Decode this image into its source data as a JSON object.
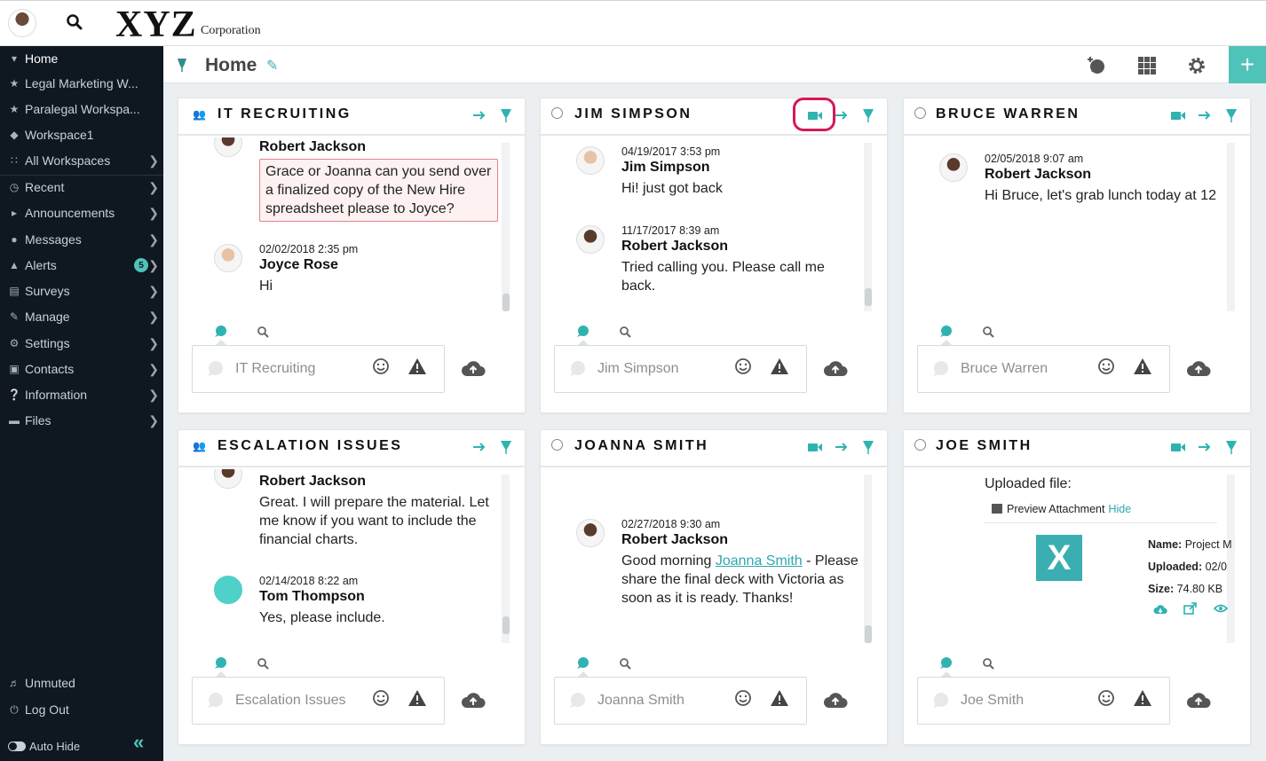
{
  "header": {
    "logo_main": "XYZ",
    "logo_sub": "Corporation"
  },
  "sidebar": {
    "items": [
      {
        "label": "Home",
        "icon": "pin-icon"
      },
      {
        "label": "Legal Marketing W...",
        "icon": "star-icon"
      },
      {
        "label": "Paralegal Workspa...",
        "icon": "star-icon"
      },
      {
        "label": "Workspace1",
        "icon": "workspace-icon"
      },
      {
        "label": "All Workspaces",
        "icon": "grid-icon"
      },
      {
        "label": "Recent",
        "icon": "history-icon"
      },
      {
        "label": "Announcements",
        "icon": "megaphone-icon"
      },
      {
        "label": "Messages",
        "icon": "chat-icon"
      },
      {
        "label": "Alerts",
        "icon": "alert-icon",
        "badge": "5"
      },
      {
        "label": "Surveys",
        "icon": "clipboard-icon"
      },
      {
        "label": "Manage",
        "icon": "pencil-icon"
      },
      {
        "label": "Settings",
        "icon": "gear-icon"
      },
      {
        "label": "Contacts",
        "icon": "contacts-icon"
      },
      {
        "label": "Information",
        "icon": "question-icon"
      },
      {
        "label": "Files",
        "icon": "folder-icon"
      }
    ],
    "unmuted": "Unmuted",
    "logout": "Log Out",
    "auto_hide": "Auto Hide"
  },
  "titlebar": {
    "title": "Home"
  },
  "colors": {
    "accent": "#4fc3b8",
    "sidebar_bg": "#0f1720",
    "highlight": "#d6175a",
    "link": "#2fa8b0"
  },
  "cards": [
    {
      "title": "IT RECRUITING",
      "placeholder": "IT Recruiting",
      "messages": [
        {
          "name": "Robert Jackson",
          "text": "Grace or Joanna can you send over a finalized copy of the New Hire spreadsheet please to Joyce?"
        },
        {
          "ts": "02/02/2018 2:35 pm",
          "name": "Joyce Rose",
          "text": "Hi"
        }
      ]
    },
    {
      "title": "JIM SIMPSON",
      "placeholder": "Jim Simpson",
      "messages": [
        {
          "ts": "04/19/2017 3:53 pm",
          "name": "Jim Simpson",
          "text": "Hi! just got back"
        },
        {
          "ts": "11/17/2017 8:39 am",
          "name": "Robert Jackson",
          "text": "Tried calling you. Please call me back."
        }
      ]
    },
    {
      "title": "BRUCE WARREN",
      "placeholder": "Bruce Warren",
      "messages": [
        {
          "ts": "02/05/2018 9:07 am",
          "name": "Robert Jackson",
          "text": "Hi Bruce, let's grab lunch today at 12"
        }
      ]
    },
    {
      "title": "ESCALATION ISSUES",
      "placeholder": "Escalation Issues",
      "messages": [
        {
          "name": "Robert Jackson",
          "text": "Great.  I will prepare the material.  Let me know if you want to include the financial charts."
        },
        {
          "ts": "02/14/2018 8:22 am",
          "name": "Tom Thompson",
          "text": "Yes, please include."
        }
      ]
    },
    {
      "title": "JOANNA SMITH",
      "placeholder": "Joanna Smith",
      "messages": [
        {
          "ts": "02/27/2018 9:30 am",
          "name": "Robert Jackson",
          "text_pre": "Good morning ",
          "mention": "Joanna Smith",
          "text_post": " - Please share the final deck with Victoria as soon as it is ready. Thanks!"
        }
      ]
    },
    {
      "title": "JOE SMITH",
      "placeholder": "Joe Smith",
      "attachment": {
        "uploaded_label": "Uploaded file:",
        "preview_label": "Preview Attachment",
        "hide_label": "Hide",
        "file_icon_letter": "X",
        "name_label": "Name:",
        "name_value": "Project M",
        "uploaded_key": "Uploaded:",
        "uploaded_value": "02/0",
        "size_label": "Size:",
        "size_value": "74.80 KB"
      }
    }
  ]
}
